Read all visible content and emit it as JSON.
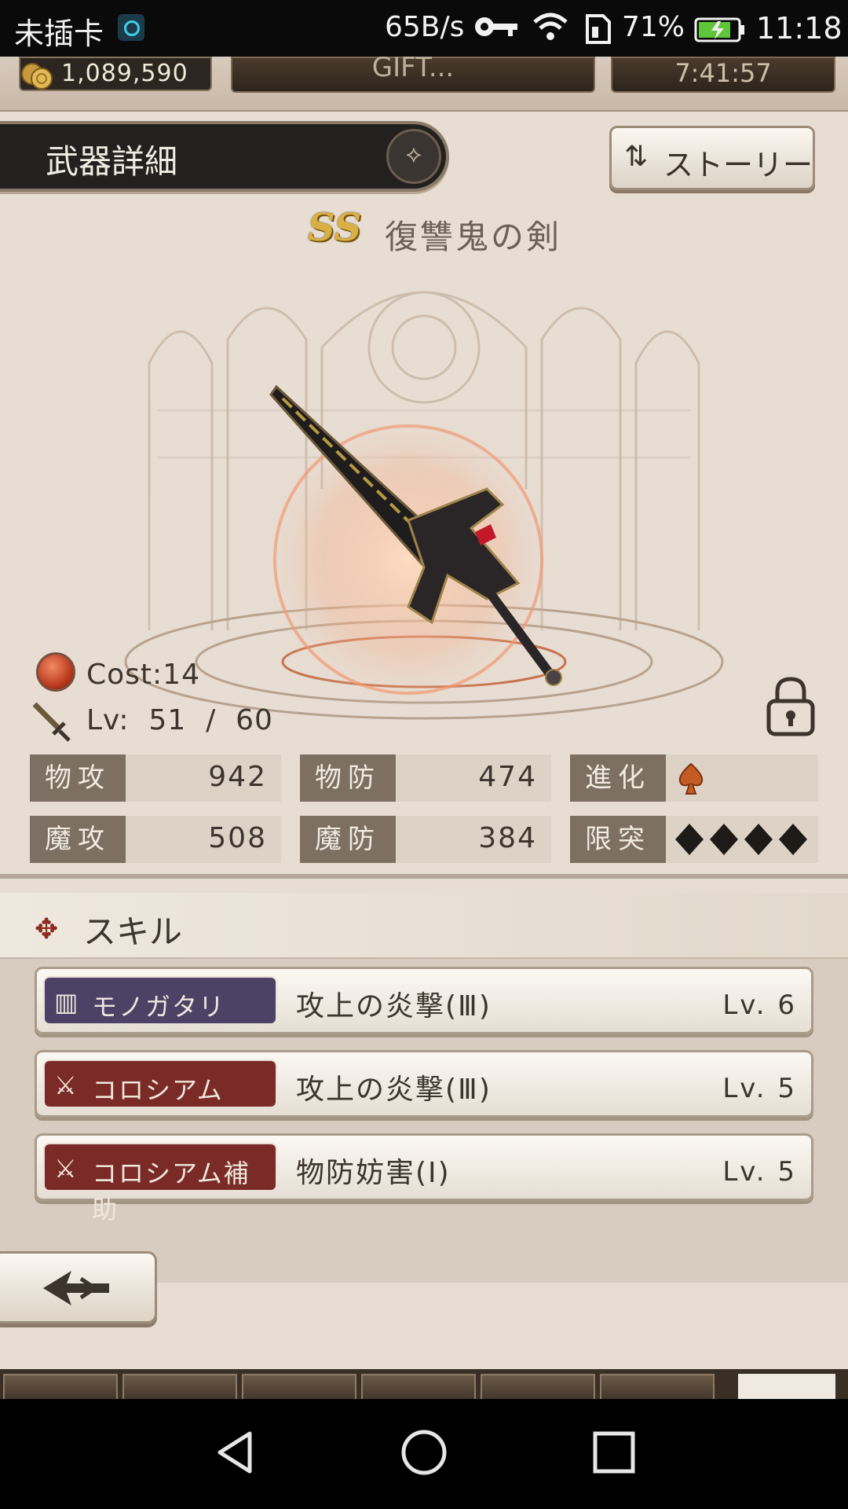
{
  "status_bar": {
    "carrier": "未插卡",
    "network_speed": "65B/s",
    "battery_percent": "71%",
    "time": "11:18"
  },
  "top_bar": {
    "gold": "1,089,590",
    "middle_label": "GIFT...",
    "timer": "7:41:57"
  },
  "header": {
    "title": "武器詳細",
    "story_button": "ストーリー"
  },
  "weapon": {
    "rank": "SS",
    "name": "復讐鬼の剣",
    "cost": "Cost:14",
    "level": "Lv:  51  /  60"
  },
  "stats": [
    {
      "label": "物攻",
      "value": "942"
    },
    {
      "label": "物防",
      "value": "474"
    },
    {
      "label": "進化",
      "value": ""
    },
    {
      "label": "魔攻",
      "value": "508"
    },
    {
      "label": "魔防",
      "value": "384"
    },
    {
      "label": "限突",
      "value": ""
    }
  ],
  "skills": {
    "heading": "スキル",
    "items": [
      {
        "type": "モノガタリ",
        "name": "攻上の炎撃(Ⅲ)",
        "level": "Lv. 6",
        "color": "#4b4266"
      },
      {
        "type": "コロシアム",
        "name": "攻上の炎撃(Ⅲ)",
        "level": "Lv. 5",
        "color": "#7a2b27"
      },
      {
        "type": "コロシアム補助",
        "name": "物防妨害(Ⅰ)",
        "level": "Lv. 5",
        "color": "#7a2b27"
      }
    ]
  },
  "icons": {
    "cost": "fire-element-icon",
    "level": "sword-icon",
    "lock": "lock-icon",
    "evolution": "spade-icon",
    "limit_break": "diamond-icon",
    "back": "back-arrow-icon"
  },
  "colors": {
    "accent_red": "#8c2a1e",
    "rank_gold": "#d9b044",
    "stat_tag": "#7d7063"
  }
}
